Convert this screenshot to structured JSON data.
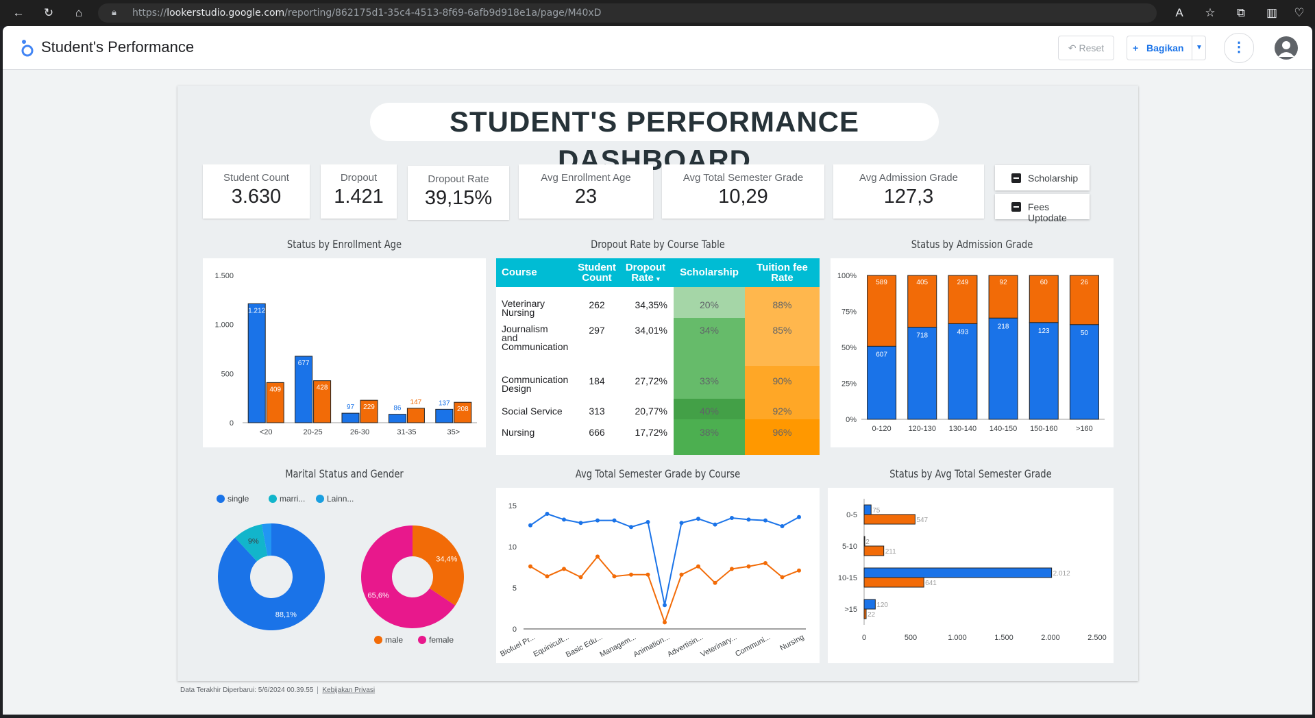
{
  "browser": {
    "url_prefix": "https://",
    "url_host": "lookerstudio.google.com",
    "url_path": "/reporting/862175d1-35c4-4513-8f69-6afb9d918e1a/page/M40xD"
  },
  "header": {
    "title": "Student's Performance",
    "reset_label": "Reset",
    "share_label": "Bagikan"
  },
  "dashboard": {
    "title": "STUDENT'S PERFORMANCE DASHBOARD",
    "kpis": [
      {
        "label": "Student Count",
        "value": "3.630"
      },
      {
        "label": "Dropout",
        "value": "1.421"
      },
      {
        "label": "Dropout Rate",
        "value": "39,15%"
      },
      {
        "label": "Avg Enrollment Age",
        "value": "23"
      },
      {
        "label": "Avg Total Semester Grade",
        "value": "10,29"
      },
      {
        "label": "Avg Admission Grade",
        "value": "127,3"
      }
    ],
    "filters": [
      {
        "label": "Scholarship"
      },
      {
        "label": "Fees Uptodate"
      }
    ]
  },
  "table": {
    "title": "Dropout Rate by Course Table",
    "columns": [
      "Course",
      "Student Count",
      "Dropout Rate",
      "Scholarship",
      "Tuition fee Rate"
    ],
    "sort_indicator": "▾",
    "rows": [
      {
        "course": "Veterinary Nursing",
        "count": "262",
        "rate": "34,35%",
        "sch": "20%",
        "fee": "88%",
        "sch_color": "#a5d6a7",
        "fee_color": "#ffb74d"
      },
      {
        "course": "Journalism and Communication",
        "count": "297",
        "rate": "34,01%",
        "sch": "34%",
        "fee": "85%",
        "sch_color": "#66bb6a",
        "fee_color": "#ffb74d"
      },
      {
        "course": "Communication Design",
        "count": "184",
        "rate": "27,72%",
        "sch": "33%",
        "fee": "90%",
        "sch_color": "#66bb6a",
        "fee_color": "#ffa726"
      },
      {
        "course": "Social Service",
        "count": "313",
        "rate": "20,77%",
        "sch": "40%",
        "fee": "92%",
        "sch_color": "#43a047",
        "fee_color": "#ffa726"
      },
      {
        "course": "Nursing",
        "count": "666",
        "rate": "17,72%",
        "sch": "38%",
        "fee": "96%",
        "sch_color": "#4caf50",
        "fee_color": "#ff9800"
      }
    ]
  },
  "chart_data": [
    {
      "type": "bar",
      "title": "Status by Enrollment Age",
      "categories": [
        "<20",
        "20-25",
        "26-30",
        "31-35",
        "35>"
      ],
      "series": [
        {
          "values": [
            1212,
            677,
            97,
            86,
            137
          ],
          "color": "#1a73e8"
        },
        {
          "values": [
            409,
            428,
            229,
            147,
            208
          ],
          "color": "#f26b07"
        }
      ],
      "value_labels": [
        [
          "1.212",
          "677",
          "97",
          "86",
          "137"
        ],
        [
          "409",
          "428",
          "229",
          "147",
          "208"
        ]
      ],
      "yticks": [
        "0",
        "500",
        "1.000",
        "1.500"
      ],
      "ylim": [
        0,
        1500
      ]
    },
    {
      "type": "bar",
      "stacked_percent": true,
      "title": "Status by Admission Grade",
      "categories": [
        "0-120",
        "120-130",
        "130-140",
        "140-150",
        "150-160",
        ">160"
      ],
      "series": [
        {
          "values": [
            607,
            718,
            493,
            218,
            123,
            50
          ],
          "color": "#1a73e8"
        },
        {
          "values": [
            589,
            405,
            249,
            92,
            60,
            26
          ],
          "color": "#f26b07"
        }
      ],
      "yticks": [
        "0%",
        "25%",
        "50%",
        "75%",
        "100%"
      ]
    },
    {
      "type": "pie",
      "title": "Marital Status and Gender",
      "donuts": [
        {
          "legend": [
            {
              "label": "single",
              "color": "#1a73e8"
            },
            {
              "label": "marri...",
              "color": "#12b5cb"
            },
            {
              "label": "Lainn...",
              "color": "#1a9fe0"
            }
          ],
          "slices": [
            {
              "value": 88.1,
              "label": "88,1%",
              "color": "#1a73e8"
            },
            {
              "value": 9.0,
              "label": "9%",
              "color": "#12b5cb"
            },
            {
              "value": 2.9,
              "label": "",
              "color": "#2196f3"
            }
          ]
        },
        {
          "legend": [
            {
              "label": "male",
              "color": "#f26b07"
            },
            {
              "label": "female",
              "color": "#e8188c"
            }
          ],
          "slices": [
            {
              "value": 34.4,
              "label": "34,4%",
              "color": "#f26b07"
            },
            {
              "value": 65.6,
              "label": "65,6%",
              "color": "#e8188c"
            }
          ]
        }
      ]
    },
    {
      "type": "line",
      "title": "Avg Total Semester Grade by Course",
      "categories": [
        "Biofuel Pr...",
        "",
        "Equinicult...",
        "",
        "Basic Edu...",
        "",
        "Managem...",
        "",
        "Animation...",
        "",
        "Advertisin...",
        "",
        "Veterinary...",
        "",
        "Communi...",
        "",
        "Nursing",
        ""
      ],
      "series": [
        {
          "values": [
            12.6,
            14.0,
            13.3,
            12.9,
            13.2,
            13.2,
            12.4,
            13.0,
            2.9,
            12.9,
            13.4,
            12.7,
            13.5,
            13.3,
            13.2,
            12.5,
            13.6
          ],
          "color": "#1a73e8"
        },
        {
          "values": [
            7.6,
            6.4,
            7.3,
            6.3,
            8.8,
            6.4,
            6.6,
            6.6,
            0.8,
            6.6,
            7.6,
            5.6,
            7.3,
            7.6,
            8.0,
            6.3,
            7.1
          ],
          "color": "#f26b07"
        }
      ],
      "yticks": [
        "0",
        "5",
        "10",
        "15"
      ],
      "ylim": [
        0,
        15
      ]
    },
    {
      "type": "bar",
      "orientation": "horizontal",
      "title": "Status by Avg Total Semester Grade",
      "categories": [
        "0-5",
        "5-10",
        "10-15",
        ">15"
      ],
      "series": [
        {
          "values": [
            75,
            2,
            2012,
            120
          ],
          "color": "#1a73e8"
        },
        {
          "values": [
            547,
            211,
            641,
            22
          ],
          "color": "#f26b07"
        }
      ],
      "value_labels": [
        [
          "75",
          "2",
          "2.012",
          "120"
        ],
        [
          "547",
          "211",
          "641",
          "22"
        ]
      ],
      "xticks": [
        "0",
        "500",
        "1.000",
        "1.500",
        "2.000",
        "2.500"
      ],
      "xlim": [
        0,
        2500
      ]
    }
  ],
  "footer": {
    "updated": "Data Terakhir Diperbarui: 5/6/2024 00.39.55",
    "privacy": "Kebijakan Privasi"
  }
}
